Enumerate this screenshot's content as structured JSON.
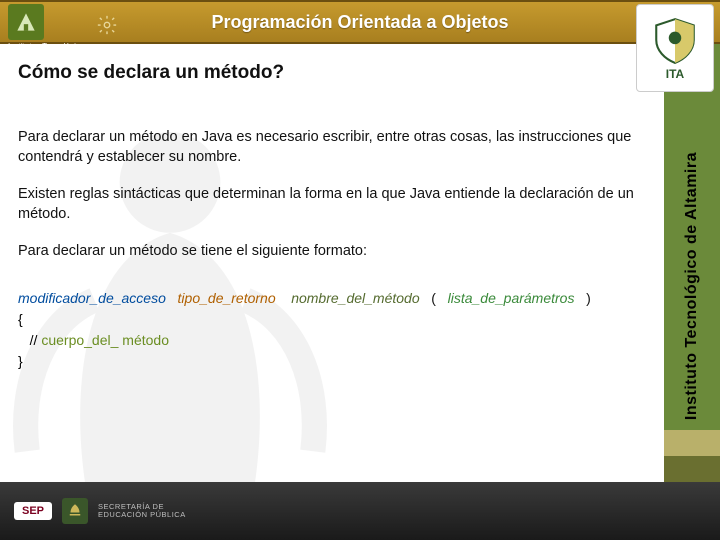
{
  "header": {
    "title": "Programación Orientada a Objetos",
    "left_label": "Institutos Tecnológicos"
  },
  "shield": {
    "abbrev": "ITA"
  },
  "subtitle": "Cómo se declara un método?",
  "paragraphs": {
    "p1": "Para declarar un método en Java es necesario escribir, entre otras cosas, las instrucciones que contendrá y establecer su nombre.",
    "p2": "Existen reglas sintácticas que determinan la forma en la que Java entiende la declaración de un método.",
    "p3": "Para declarar un método se tiene el siguiente formato:"
  },
  "syntax": {
    "mod": "modificador_de_acceso",
    "ret": "tipo_de_retorno",
    "name": "nombre_del_método",
    "lpar": "(",
    "params": "lista_de_parámetros",
    "rpar": ")",
    "open": "{",
    "comment_prefix": "   // ",
    "body": "cuerpo_del_ método",
    "close": "}"
  },
  "sidebar": {
    "text": "Instituto Tecnológico de Altamira"
  },
  "footer": {
    "sep": "SEP",
    "line1": "SECRETARÍA DE",
    "line2": "EDUCACIÓN PÚBLICA"
  }
}
